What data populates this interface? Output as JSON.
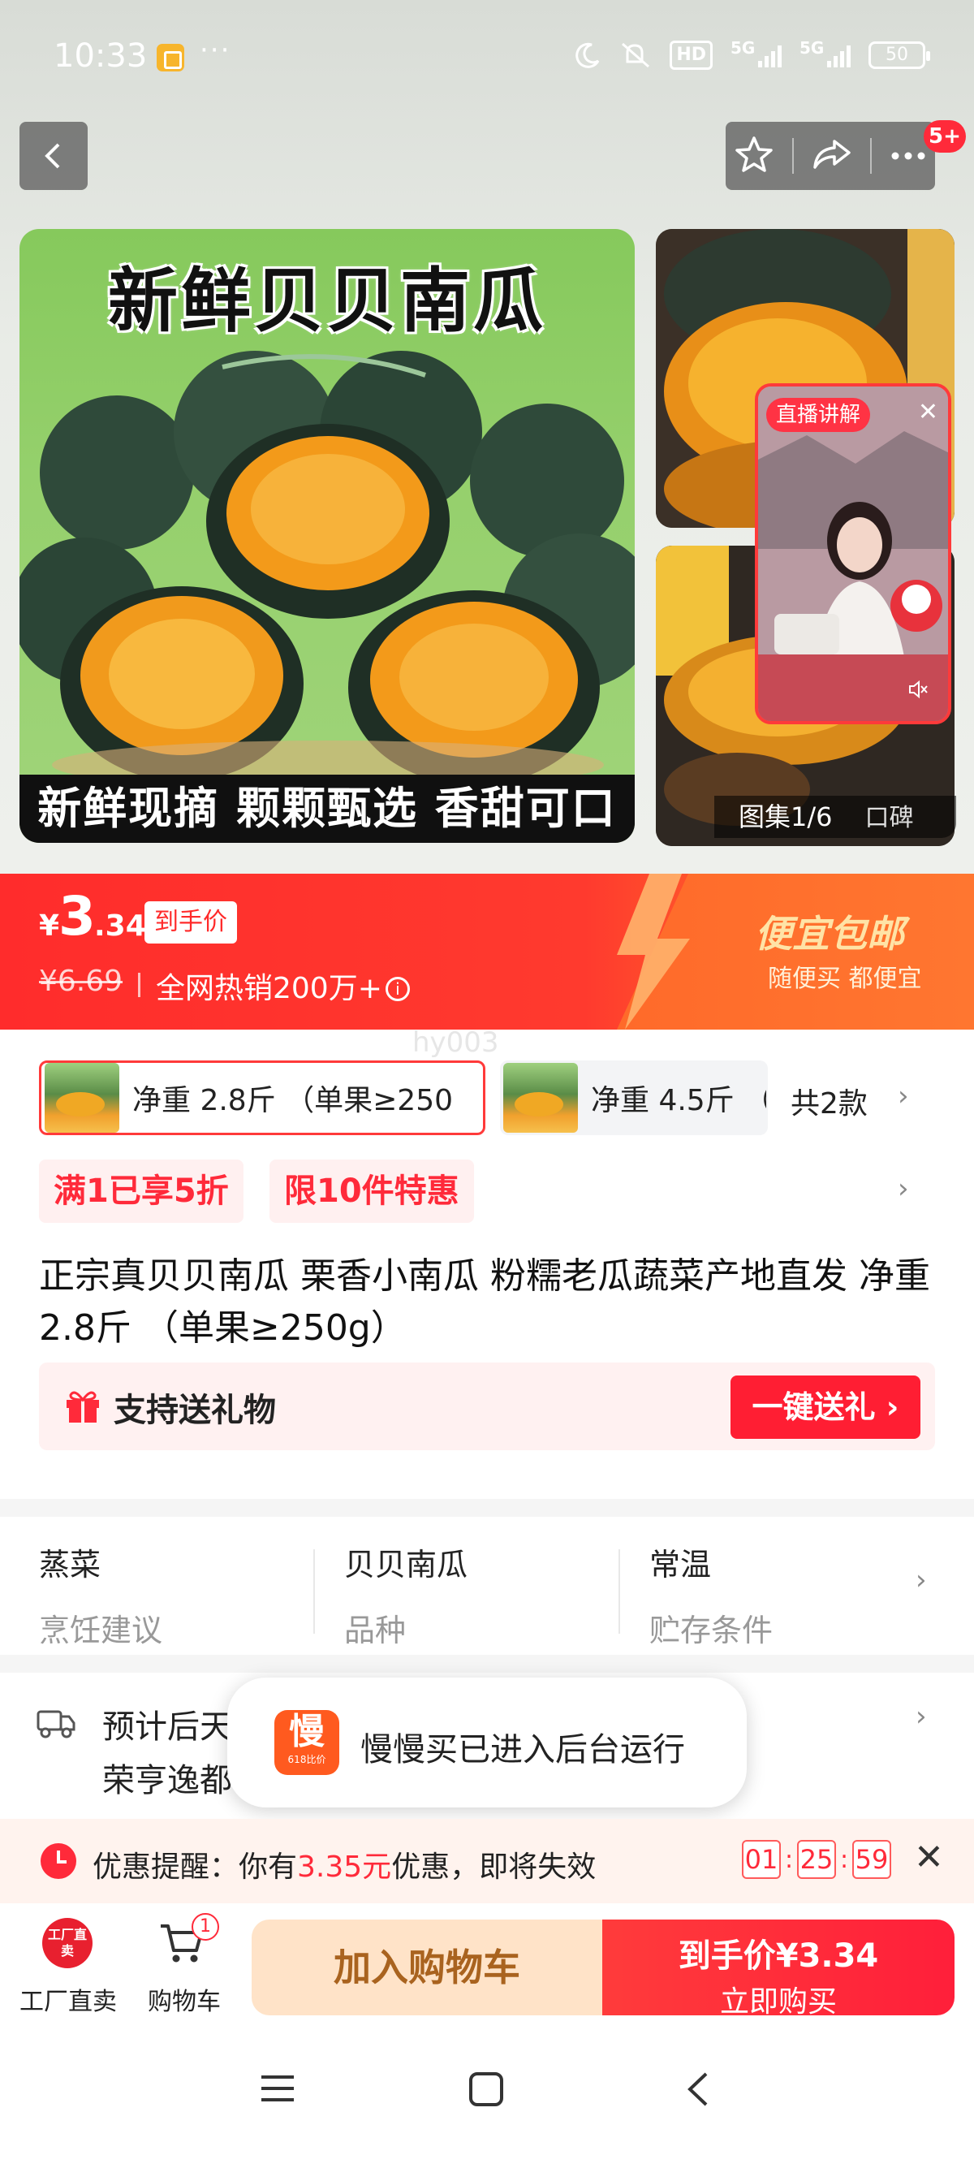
{
  "status_bar": {
    "time": "10:33",
    "dots": "···",
    "hd": "HD",
    "net1": "5G",
    "net2": "5G",
    "battery": "50"
  },
  "nav": {
    "more_badge": "5+"
  },
  "gallery": {
    "main_title": "新鲜贝贝南瓜",
    "main_banner": "新鲜现摘 颗颗甄选 香甜可口",
    "count_label": "图集1/6",
    "reviews_label": "口碑",
    "live_label": "直播讲解",
    "live_close": "✕"
  },
  "price": {
    "currency": "¥",
    "integer": "3",
    "decimal": ".34",
    "tag": "到手价",
    "original": "¥6.69",
    "sales": "全网热销200万+",
    "promo_title": "便宜包邮",
    "promo_sub": "随便买 都便宜",
    "watermark": "hy003"
  },
  "variants": {
    "items": [
      {
        "label": "净重 2.8斤 （单果≥250",
        "selected": true
      },
      {
        "label": "净重 4.5斤 （",
        "selected": false
      }
    ],
    "count": "共2款"
  },
  "promos": [
    "满1已享5折",
    "限10件特惠"
  ],
  "product": {
    "title": "正宗真贝贝南瓜 栗香小南瓜 粉糯老瓜蔬菜产地直发 净重 2.8斤 （单果≥250g）"
  },
  "gift": {
    "label": "支持送礼物",
    "button": "一键送礼 ›"
  },
  "specs": [
    {
      "value": "蒸菜",
      "key": "烹饪建议"
    },
    {
      "value": "贝贝南瓜",
      "key": "品种"
    },
    {
      "value": "常温",
      "key": "贮存条件"
    }
  ],
  "delivery": {
    "line1": "预计后天",
    "line2": "荣亨逸都"
  },
  "toast": {
    "icon_text": "慢",
    "icon_sub": "618比价",
    "message": "慢慢买已进入后台运行"
  },
  "reminder": {
    "prefix": "优惠提醒：你有",
    "amount": "3.35元",
    "suffix": "优惠，即将失效",
    "timer": [
      "01",
      "25",
      "59"
    ]
  },
  "bottom_bar": {
    "factory_icon": "工厂直卖",
    "factory_label": "工厂直卖",
    "cart_label": "购物车",
    "cart_count": "1",
    "add_cart": "加入购物车",
    "buy_line1": "到手价¥3.34",
    "buy_line2": "立即购买"
  },
  "colors": {
    "accent": "#ff2a3a",
    "price_bar": "#ff3a2e",
    "add_cart_bg": "#ffe3c8"
  }
}
